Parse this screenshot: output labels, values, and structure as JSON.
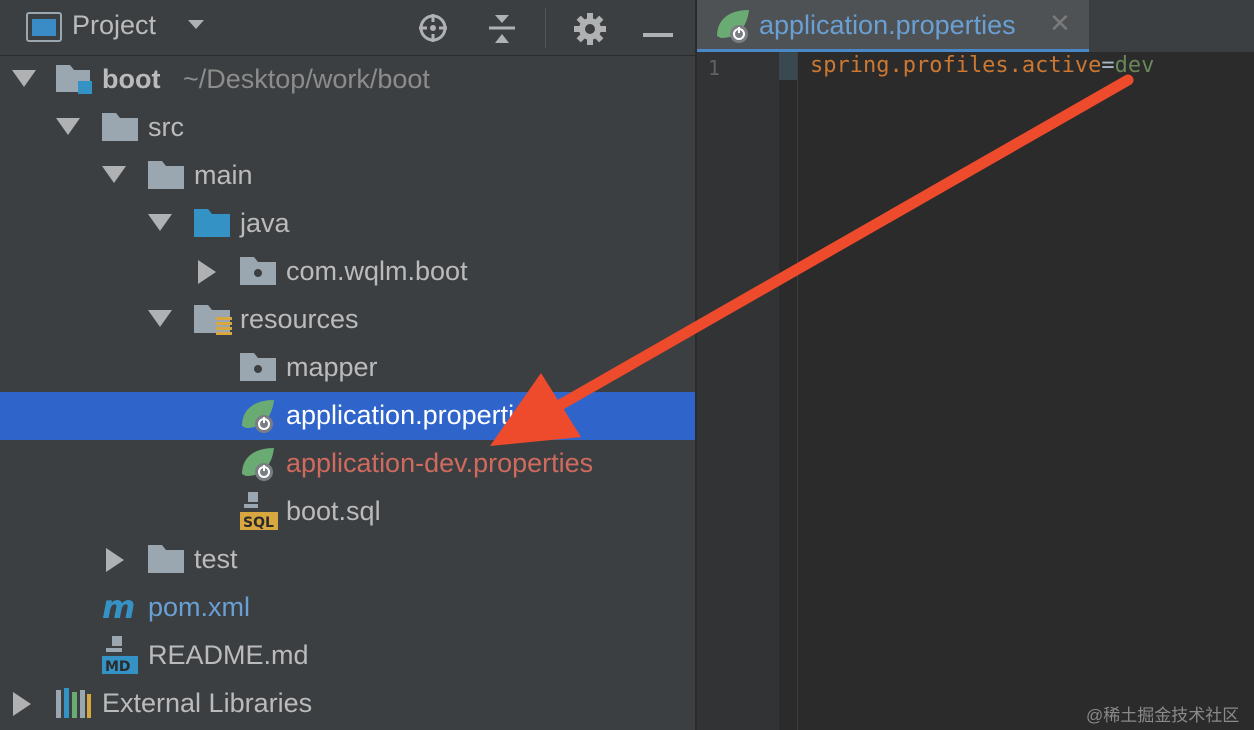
{
  "panel": {
    "title": "Project",
    "tools": [
      "locate-icon",
      "collapse-icon",
      "gear-icon",
      "minimize-icon"
    ]
  },
  "tree": {
    "root_name": "boot",
    "root_path": "~/Desktop/work/boot",
    "items": {
      "src": "src",
      "main": "main",
      "java": "java",
      "pkg": "com.wqlm.boot",
      "resources": "resources",
      "mapper": "mapper",
      "app_props": "application.properties",
      "app_dev_props": "application-dev.properties",
      "boot_sql": "boot.sql",
      "test": "test",
      "pom": "pom.xml",
      "readme": "README.md",
      "external": "External Libraries"
    },
    "selected": "application.properties"
  },
  "editor": {
    "tab_label": "application.properties",
    "tab_close": "✕",
    "line_number": "1",
    "code_key": "spring.profiles.active",
    "code_eq": "=",
    "code_value": "dev"
  },
  "colors": {
    "selection": "#2f65ca",
    "arrow": "#ee4a2c",
    "modified_file": "#d06a5e"
  },
  "watermark": "@稀土掘金技术社区"
}
